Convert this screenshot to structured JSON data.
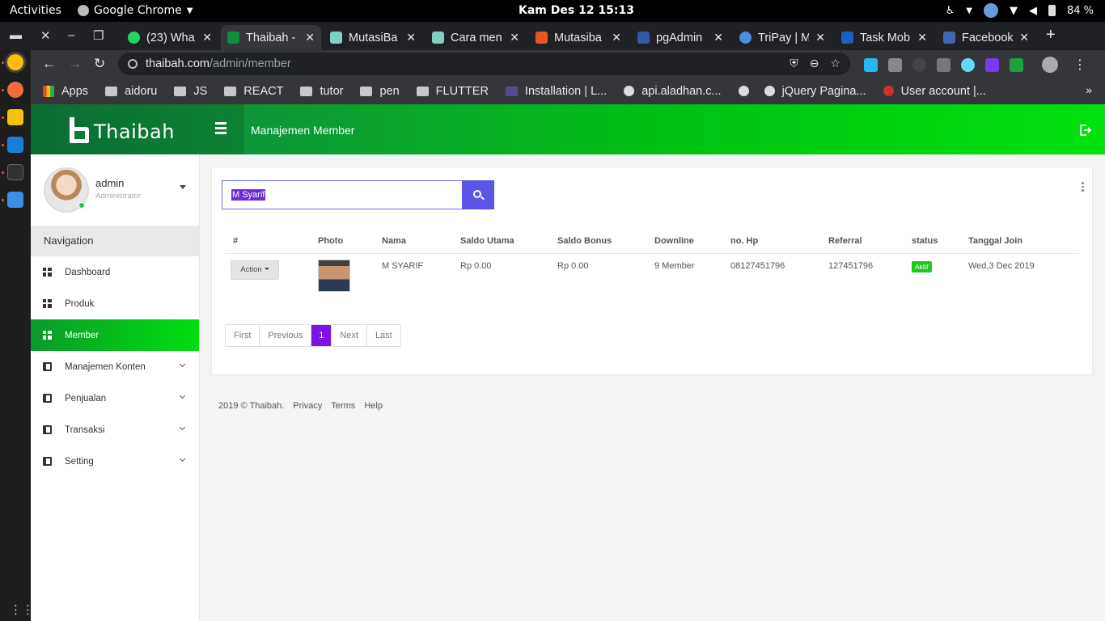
{
  "gnome": {
    "activities": "Activities",
    "app_name": "Google Chrome",
    "clock": "Kam Des 12  15:13",
    "battery": "84 %"
  },
  "tabs": [
    {
      "title": "(23) Wha",
      "icon": "whatsapp-icon",
      "color": "#25d366"
    },
    {
      "title": "Thaibah -",
      "icon": "thaibah-icon",
      "color": "#0f8f3c",
      "active": true
    },
    {
      "title": "MutasiBa",
      "icon": "mutasi-icon",
      "color": "#7fd0c3"
    },
    {
      "title": "Cara men",
      "icon": "mutasi-icon",
      "color": "#7fd0c3"
    },
    {
      "title": "Mutasiba",
      "icon": "mutasibank-icon",
      "color": "#e95420"
    },
    {
      "title": "pgAdmin",
      "icon": "pgadmin-icon",
      "color": "#2f5aa8"
    },
    {
      "title": "TriPay | M",
      "icon": "tripay-icon",
      "color": "#4a90e2"
    },
    {
      "title": "Task Mob",
      "icon": "trello-icon",
      "color": "#1565c0"
    },
    {
      "title": "Facebook",
      "icon": "facebook-icon",
      "color": "#4267b2"
    }
  ],
  "address": {
    "host": "thaibah.com",
    "path": "/admin/member"
  },
  "bookmarks": [
    {
      "label": "Apps",
      "icon": "apps-icon"
    },
    {
      "label": "aidoru",
      "icon": "folder-icon"
    },
    {
      "label": "JS",
      "icon": "folder-icon"
    },
    {
      "label": "REACT",
      "icon": "folder-icon"
    },
    {
      "label": "tutor",
      "icon": "folder-icon"
    },
    {
      "label": "pen",
      "icon": "folder-icon"
    },
    {
      "label": "FLUTTER",
      "icon": "folder-icon"
    },
    {
      "label": "Installation | L...",
      "icon": "laravel-icon"
    },
    {
      "label": "api.aladhan.c...",
      "icon": "globe-icon"
    },
    {
      "label": "",
      "icon": "globe-icon"
    },
    {
      "label": "jQuery Pagina...",
      "icon": "globe-icon"
    },
    {
      "label": "User account |...",
      "icon": "account-icon"
    }
  ],
  "header": {
    "brand": "Thaibah",
    "page_title": "Manajemen Member"
  },
  "user": {
    "name": "admin",
    "role": "Administrator"
  },
  "nav": {
    "heading": "Navigation",
    "items": [
      {
        "label": "Dashboard",
        "icon": "grid-icon"
      },
      {
        "label": "Produk",
        "icon": "grid-icon"
      },
      {
        "label": "Member",
        "icon": "grid-icon",
        "active": true
      },
      {
        "label": "Manajemen Konten",
        "icon": "book-icon",
        "has_children": true
      },
      {
        "label": "Penjualan",
        "icon": "book-icon",
        "has_children": true
      },
      {
        "label": "Transaksi",
        "icon": "book-icon",
        "has_children": true
      },
      {
        "label": "Setting",
        "icon": "book-icon",
        "has_children": true
      }
    ]
  },
  "search": {
    "value": "M Syarif"
  },
  "table": {
    "headers": [
      "#",
      "Photo",
      "Nama",
      "Saldo Utama",
      "Saldo Bonus",
      "Downline",
      "no. Hp",
      "Referral",
      "status",
      "Tanggal Join"
    ],
    "rows": [
      {
        "action": "Action",
        "nama": "M SYARIF",
        "saldo_utama": "Rp 0.00",
        "saldo_bonus": "Rp 0.00",
        "downline": "9 Member",
        "hp": "08127451796",
        "referral": "127451796",
        "status": "Aktif",
        "tanggal_join": "Wed,3 Dec 2019"
      }
    ]
  },
  "pagination": {
    "first": "First",
    "previous": "Previous",
    "current": "1",
    "next": "Next",
    "last": "Last"
  },
  "footer": {
    "copyright": "2019 © Thaibah.",
    "privacy": "Privacy",
    "terms": "Terms",
    "help": "Help"
  },
  "colors": {
    "accent": "#5a55e6",
    "green": "#00c213",
    "status_active": "#1fc71f",
    "pager_current": "#7a12e6"
  }
}
